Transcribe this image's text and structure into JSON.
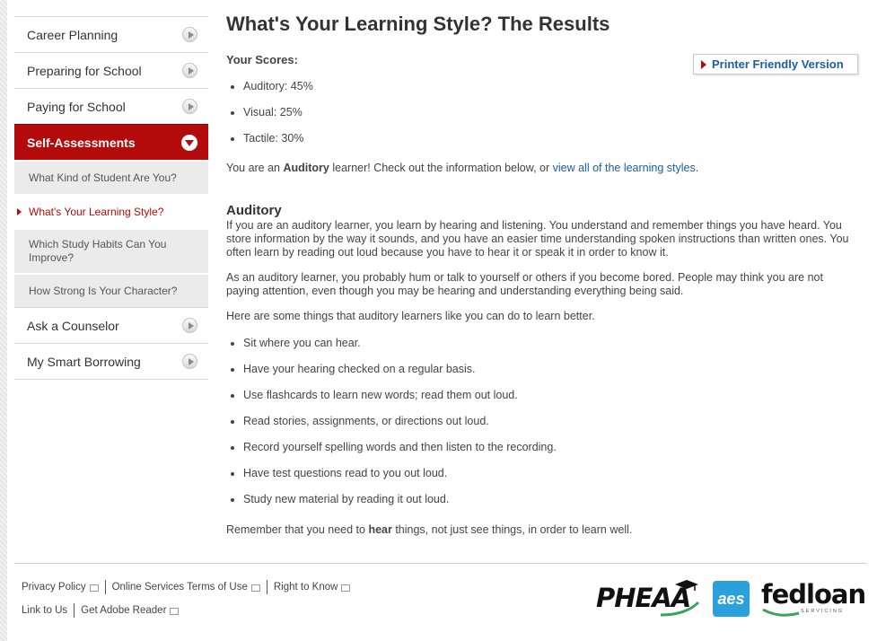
{
  "sidebar": {
    "items": [
      {
        "label": "Career Planning"
      },
      {
        "label": "Preparing for School"
      },
      {
        "label": "Paying for School"
      },
      {
        "label": "Self-Assessments"
      }
    ],
    "sub_items": [
      {
        "label": "What Kind of Student Are You?"
      },
      {
        "label": "What's Your Learning Style?"
      },
      {
        "label": "Which Study Habits Can You Improve?"
      },
      {
        "label": "How Strong Is Your Character?"
      }
    ],
    "bottom_items": [
      {
        "label": "Ask a Counselor"
      },
      {
        "label": "My Smart Borrowing"
      }
    ]
  },
  "main": {
    "title": "What's Your Learning Style? The Results",
    "printer_button": "Printer Friendly Version",
    "scores_heading": "Your Scores:",
    "scores": [
      "Auditory: 45%",
      "Visual: 25%",
      "Tactile: 30%"
    ],
    "result_prefix": "You are an ",
    "result_style": "Auditory",
    "result_middle": " learner! Check out the information below, or ",
    "result_link": "view all of the learning styles",
    "result_suffix": ".",
    "section_heading": "Auditory",
    "para1": "If you are an auditory learner, you learn by hearing and listening. You understand and remember things you have heard. You store information by the way it sounds, and you have an easier time understanding spoken instructions than written ones. You often learn by reading out loud because you have to hear it or speak it in order to know it.",
    "para2": "As an auditory learner, you probably hum or talk to yourself or others if you become bored. People may think you are not paying attention, even though you may be hearing and understanding everything being said.",
    "para3": "Here are some things that auditory learners like you can do to learn better.",
    "tips": [
      "Sit where you can hear.",
      "Have your hearing checked on a regular basis.",
      "Use flashcards to learn new words; read them out loud.",
      "Read stories, assignments, or directions out loud.",
      "Record yourself spelling words and then listen to the recording.",
      "Have test questions read to you out loud.",
      "Study new material by reading it out loud."
    ],
    "closing_prefix": "Remember that you need to ",
    "closing_bold": "hear",
    "closing_suffix": " things, not just see things, in order to learn well."
  },
  "footer": {
    "row1": [
      "Privacy Policy",
      "Online Services Terms of Use",
      "Right to Know"
    ],
    "row2": [
      "Link to Us",
      "Get Adobe Reader"
    ],
    "logos": {
      "pheaa": "PHEAA",
      "aes": "aes",
      "fedloan": "fedloan",
      "servicing": "SERVICING"
    }
  }
}
